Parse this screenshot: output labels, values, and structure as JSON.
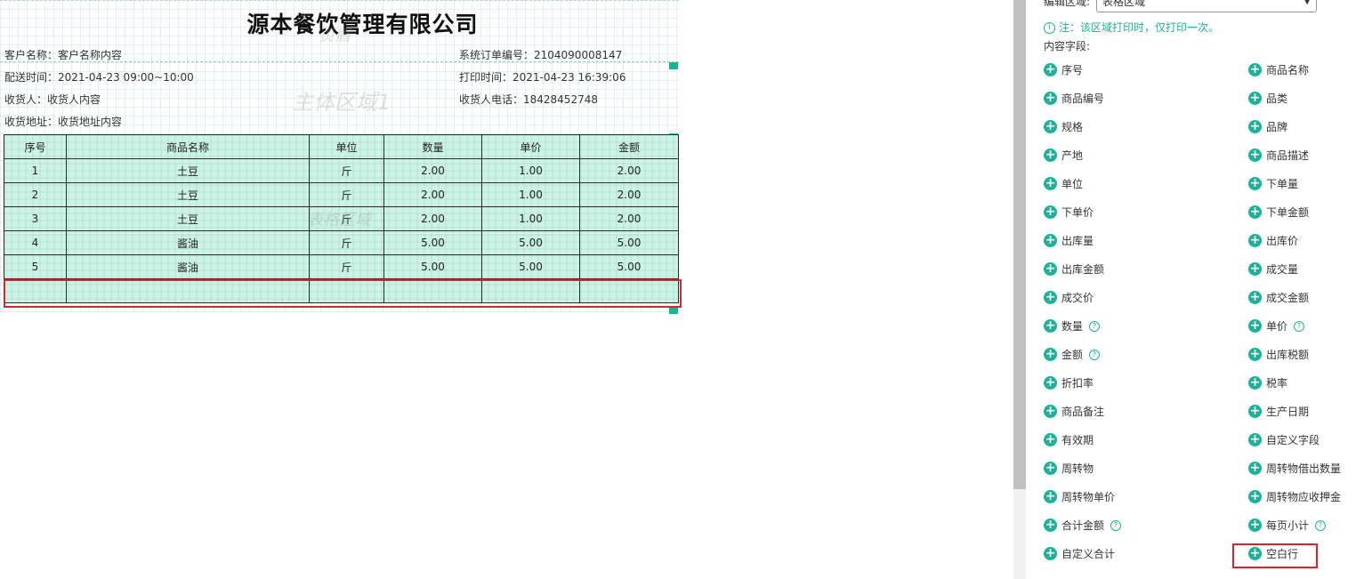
{
  "document": {
    "company_title": "源本餐饮管理有限公司",
    "ghost_header": "页眉",
    "ghost_main": "主体区域1",
    "ghost_table": "表格区域",
    "customer_name": "客户名称：客户名称内容",
    "order_no": "系统订单编号：2104090008147",
    "delivery_time": "配送时间：2021-04-23 09:00~10:00",
    "print_time": "打印时间：2021-04-23 16:39:06",
    "receiver": "收货人：收货人内容",
    "receiver_phone": "收货人电话：18428452748",
    "address": "收货地址：收货地址内容"
  },
  "table": {
    "headers": [
      "序号",
      "商品名称",
      "单位",
      "数量",
      "单价",
      "金额"
    ],
    "rows": [
      [
        "1",
        "土豆",
        "斤",
        "2.00",
        "1.00",
        "2.00"
      ],
      [
        "2",
        "土豆",
        "斤",
        "2.00",
        "1.00",
        "2.00"
      ],
      [
        "3",
        "土豆",
        "斤",
        "2.00",
        "1.00",
        "2.00"
      ],
      [
        "4",
        "酱油",
        "斤",
        "5.00",
        "5.00",
        "5.00"
      ],
      [
        "5",
        "酱油",
        "斤",
        "5.00",
        "5.00",
        "5.00"
      ]
    ]
  },
  "panel": {
    "edit_label": "编辑区域:",
    "region_value": "表格区域",
    "note": "注：该区域打印时，仅打印一次。",
    "fields_label": "内容字段:",
    "fields": [
      {
        "label": "序号",
        "help": false
      },
      {
        "label": "商品名称",
        "help": false
      },
      {
        "label": "商品编号",
        "help": false
      },
      {
        "label": "品类",
        "help": false
      },
      {
        "label": "规格",
        "help": false
      },
      {
        "label": "品牌",
        "help": false
      },
      {
        "label": "产地",
        "help": false
      },
      {
        "label": "商品描述",
        "help": false
      },
      {
        "label": "单位",
        "help": false
      },
      {
        "label": "下单量",
        "help": false
      },
      {
        "label": "下单价",
        "help": false
      },
      {
        "label": "下单金额",
        "help": false
      },
      {
        "label": "出库量",
        "help": false
      },
      {
        "label": "出库价",
        "help": false
      },
      {
        "label": "出库金额",
        "help": false
      },
      {
        "label": "成交量",
        "help": false
      },
      {
        "label": "成交价",
        "help": false
      },
      {
        "label": "成交金额",
        "help": false
      },
      {
        "label": "数量",
        "help": true
      },
      {
        "label": "单价",
        "help": true
      },
      {
        "label": "金额",
        "help": true
      },
      {
        "label": "出库税额",
        "help": false
      },
      {
        "label": "折扣率",
        "help": false
      },
      {
        "label": "税率",
        "help": false
      },
      {
        "label": "商品备注",
        "help": false
      },
      {
        "label": "生产日期",
        "help": false
      },
      {
        "label": "有效期",
        "help": false
      },
      {
        "label": "自定义字段",
        "help": false
      },
      {
        "label": "周转物",
        "help": false
      },
      {
        "label": "周转物借出数量",
        "help": false
      },
      {
        "label": "周转物单价",
        "help": false
      },
      {
        "label": "周转物应收押金",
        "help": false
      },
      {
        "label": "合计金额",
        "help": true
      },
      {
        "label": "每页小计",
        "help": true
      },
      {
        "label": "自定义合计",
        "help": false
      },
      {
        "label": "空白行",
        "help": false
      }
    ]
  },
  "colors": {
    "accent": "#1bb394",
    "highlight": "#d7262e",
    "table_fill": "#cdf3e6"
  }
}
